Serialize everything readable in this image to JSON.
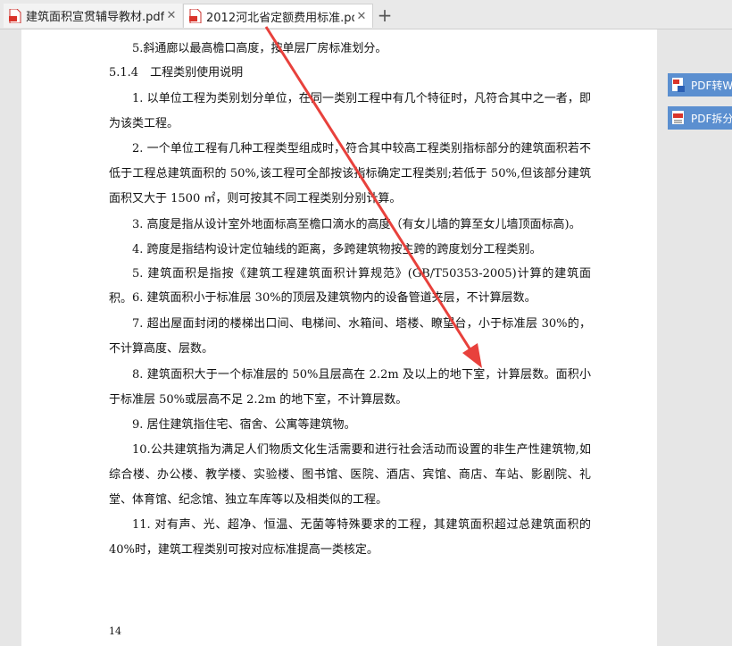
{
  "tabs": [
    {
      "title": "建筑面积宣贯辅导教材.pdf",
      "close": "✕"
    },
    {
      "title": "2012河北省定额费用标准.pdf",
      "close": "✕"
    }
  ],
  "new_tab": "+",
  "document": {
    "paragraphs": [
      "5.斜通廊以最高檐口高度，按单层厂房标准划分。",
      "5.1.4　工程类别使用说明",
      "1. 以单位工程为类别划分单位，在同一类别工程中有几个特征时，凡符合其中之一者，即为该类工程。",
      "2. 一个单位工程有几种工程类型组成时，符合其中较高工程类别指标部分的建筑面积若不低于工程总建筑面积的 50%,该工程可全部按该指标确定工程类别;若低于 50%,但该部分建筑面积又大于 1500 ㎡，则可按其不同工程类别分别计算。",
      "3. 高度是指从设计室外地面标高至檐口滴水的高度（有女儿墙的算至女儿墙顶面标高)。",
      "4. 跨度是指结构设计定位轴线的距离，多跨建筑物按主跨的跨度划分工程类别。",
      "5. 建筑面积是指按《建筑工程建筑面积计算规范》(GB/T50353-2005)计算的建筑面积。",
      "6. 建筑面积小于标准层 30%的顶层及建筑物内的设备管道夹层，不计算层数。",
      "7. 超出屋面封闭的楼梯出口间、电梯间、水箱间、塔楼、瞭望台，小于标准层 30%的，不计算高度、层数。",
      "8. 建筑面积大于一个标准层的 50%且层高在 2.2m 及以上的地下室，计算层数。面积小于标准层 50%或层高不足 2.2m 的地下室，不计算层数。",
      "9. 居住建筑指住宅、宿舍、公寓等建筑物。",
      "10.公共建筑指为满足人们物质文化生活需要和进行社会活动而设置的非生产性建筑物,如综合楼、办公楼、教学楼、实验楼、图书馆、医院、酒店、宾馆、商店、车站、影剧院、礼堂、体育馆、纪念馆、独立车库等以及相类似的工程。",
      "11. 对有声、光、超净、恒温、无菌等特殊要求的工程，其建筑面积超过总建筑面积的 40%时，建筑工程类别可按对应标准提高一类核定。"
    ],
    "page_number": "14"
  },
  "side_buttons": [
    {
      "label": "PDF转W",
      "icon": "pdf-to-word-icon"
    },
    {
      "label": "PDF拆分",
      "icon": "pdf-split-icon"
    }
  ],
  "colors": {
    "accent": "#5b8fd0",
    "pdf_icon": "#d9342b",
    "annotation_arrow": "#e8413c"
  }
}
